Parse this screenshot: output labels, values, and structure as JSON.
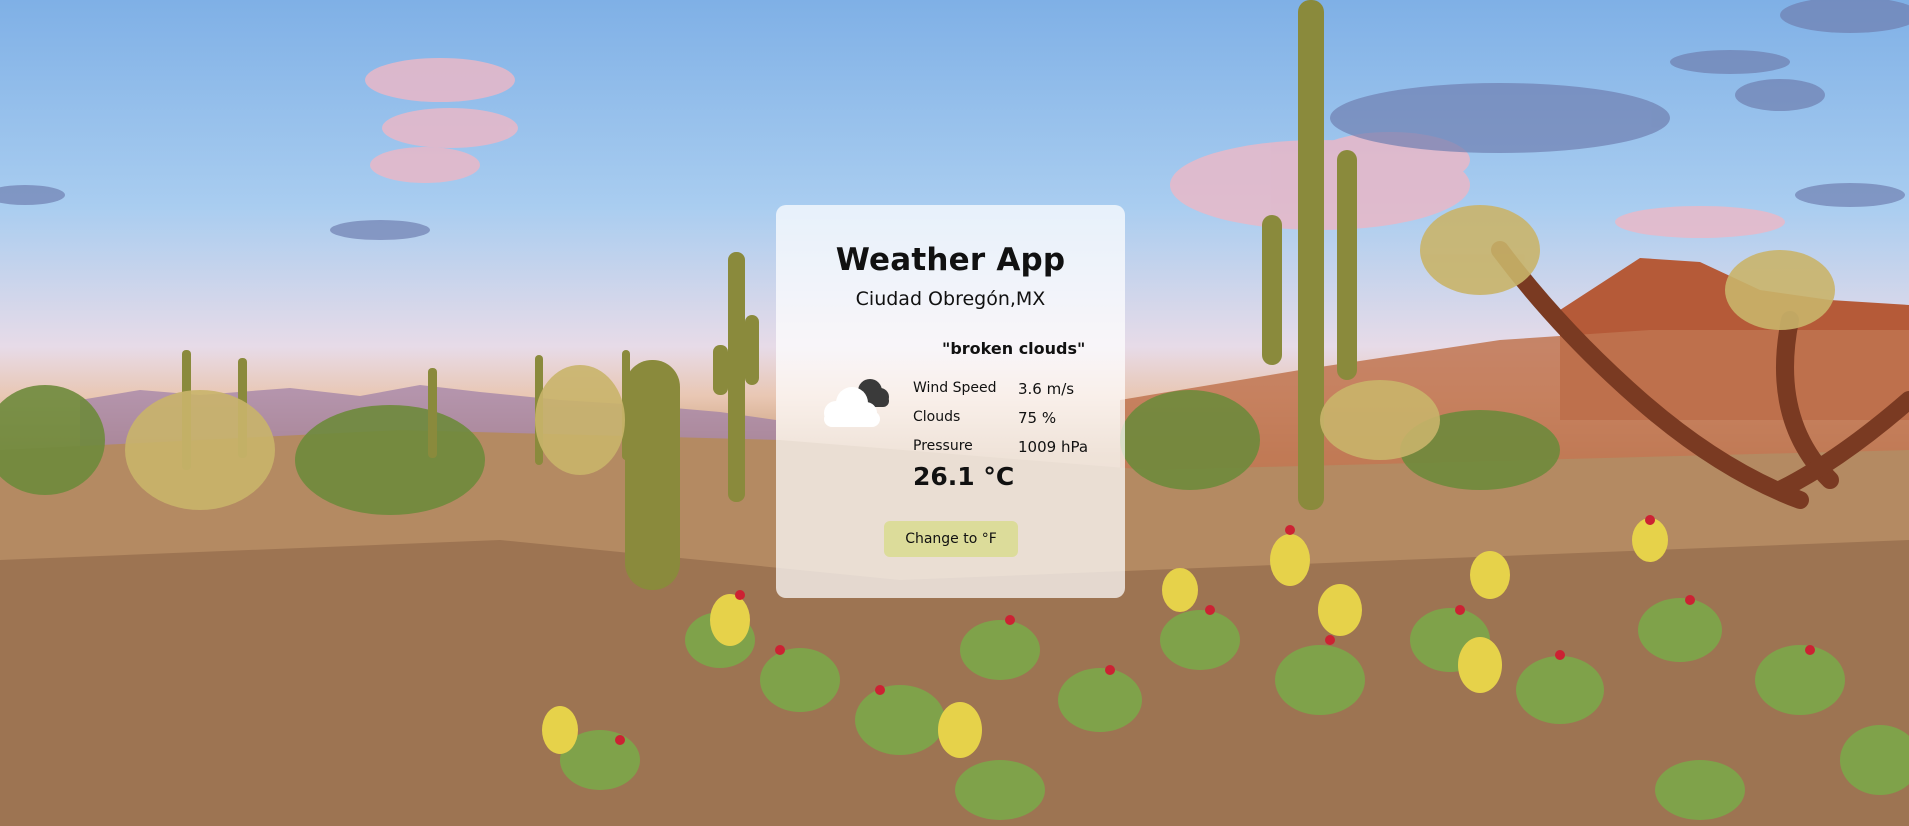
{
  "app": {
    "title": "Weather App",
    "location": "Ciudad Obregón,MX",
    "description": "\"broken clouds\"",
    "icon": "broken-clouds-icon"
  },
  "stats": [
    {
      "label": "Wind Speed",
      "value": "3.6 m/s"
    },
    {
      "label": "Clouds",
      "value": "75 %"
    },
    {
      "label": "Pressure",
      "value": "1009 hPa"
    }
  ],
  "temperature": "26.1 °C",
  "button": {
    "label": "Change to °F"
  },
  "colors": {
    "card_background": "rgba(255,255,255,0.72)",
    "button_background": "#dcdc9a",
    "text": "#111111"
  },
  "background": "desert-cactus-landscape-photo"
}
